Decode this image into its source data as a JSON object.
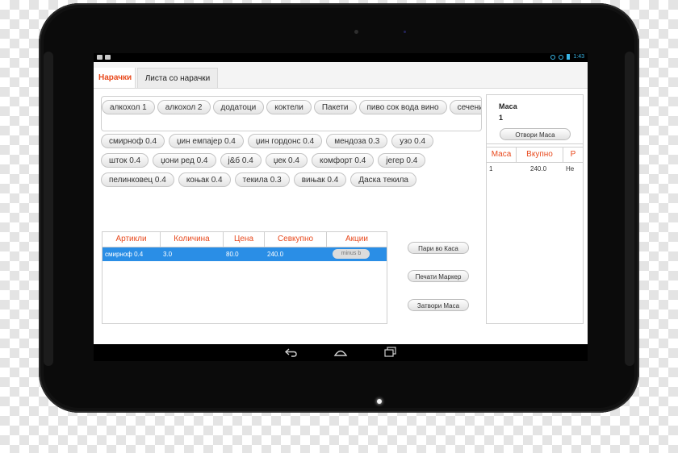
{
  "tabs": [
    {
      "label": "Наpачки",
      "active": true
    },
    {
      "label": "Листа со нарачки",
      "active": false
    }
  ],
  "status_bar": {
    "time": "1:43"
  },
  "categories": [
    "алкохол 1",
    "алкохол 2",
    "додатоци",
    "коктели",
    "Пакети",
    "пиво сок вода вино",
    "сечени"
  ],
  "items": [
    "смирноф 0.4",
    "џин емпајер 0.4",
    "џин гордонс 0.4",
    "мендоза 0.3",
    "узо 0.4",
    "шток 0.4",
    "џони ред 0.4",
    "j&б 0.4",
    "џек 0.4",
    "комфорт 0.4",
    "јегер 0.4",
    "пелинковец 0.4",
    "коњак 0.4",
    "текила 0.3",
    "вињак 0.4",
    "Даска текила"
  ],
  "order_table": {
    "headers": [
      "Артикли",
      "Количина",
      "Цена",
      "Севкупно",
      "Акции"
    ],
    "rows": [
      {
        "article": "смирноф 0.4",
        "qty": "3.0",
        "price": "80.0",
        "total": "240.0",
        "action": "minus b"
      }
    ]
  },
  "actions": {
    "pay": "Пари во Каса",
    "print": "Печати Маркер",
    "close": "Затвори Маса"
  },
  "table_panel": {
    "label": "Маса",
    "number": "1",
    "open_button": "Отвори Маса",
    "headers": [
      "Маса",
      "Вкупно",
      "Р"
    ],
    "rows": [
      {
        "table": "1",
        "total": "240.0",
        "flag": "Не"
      }
    ]
  },
  "colors": {
    "accent": "#e8491d",
    "selection": "#2a8ee6",
    "system_blue": "#39b7e8"
  }
}
